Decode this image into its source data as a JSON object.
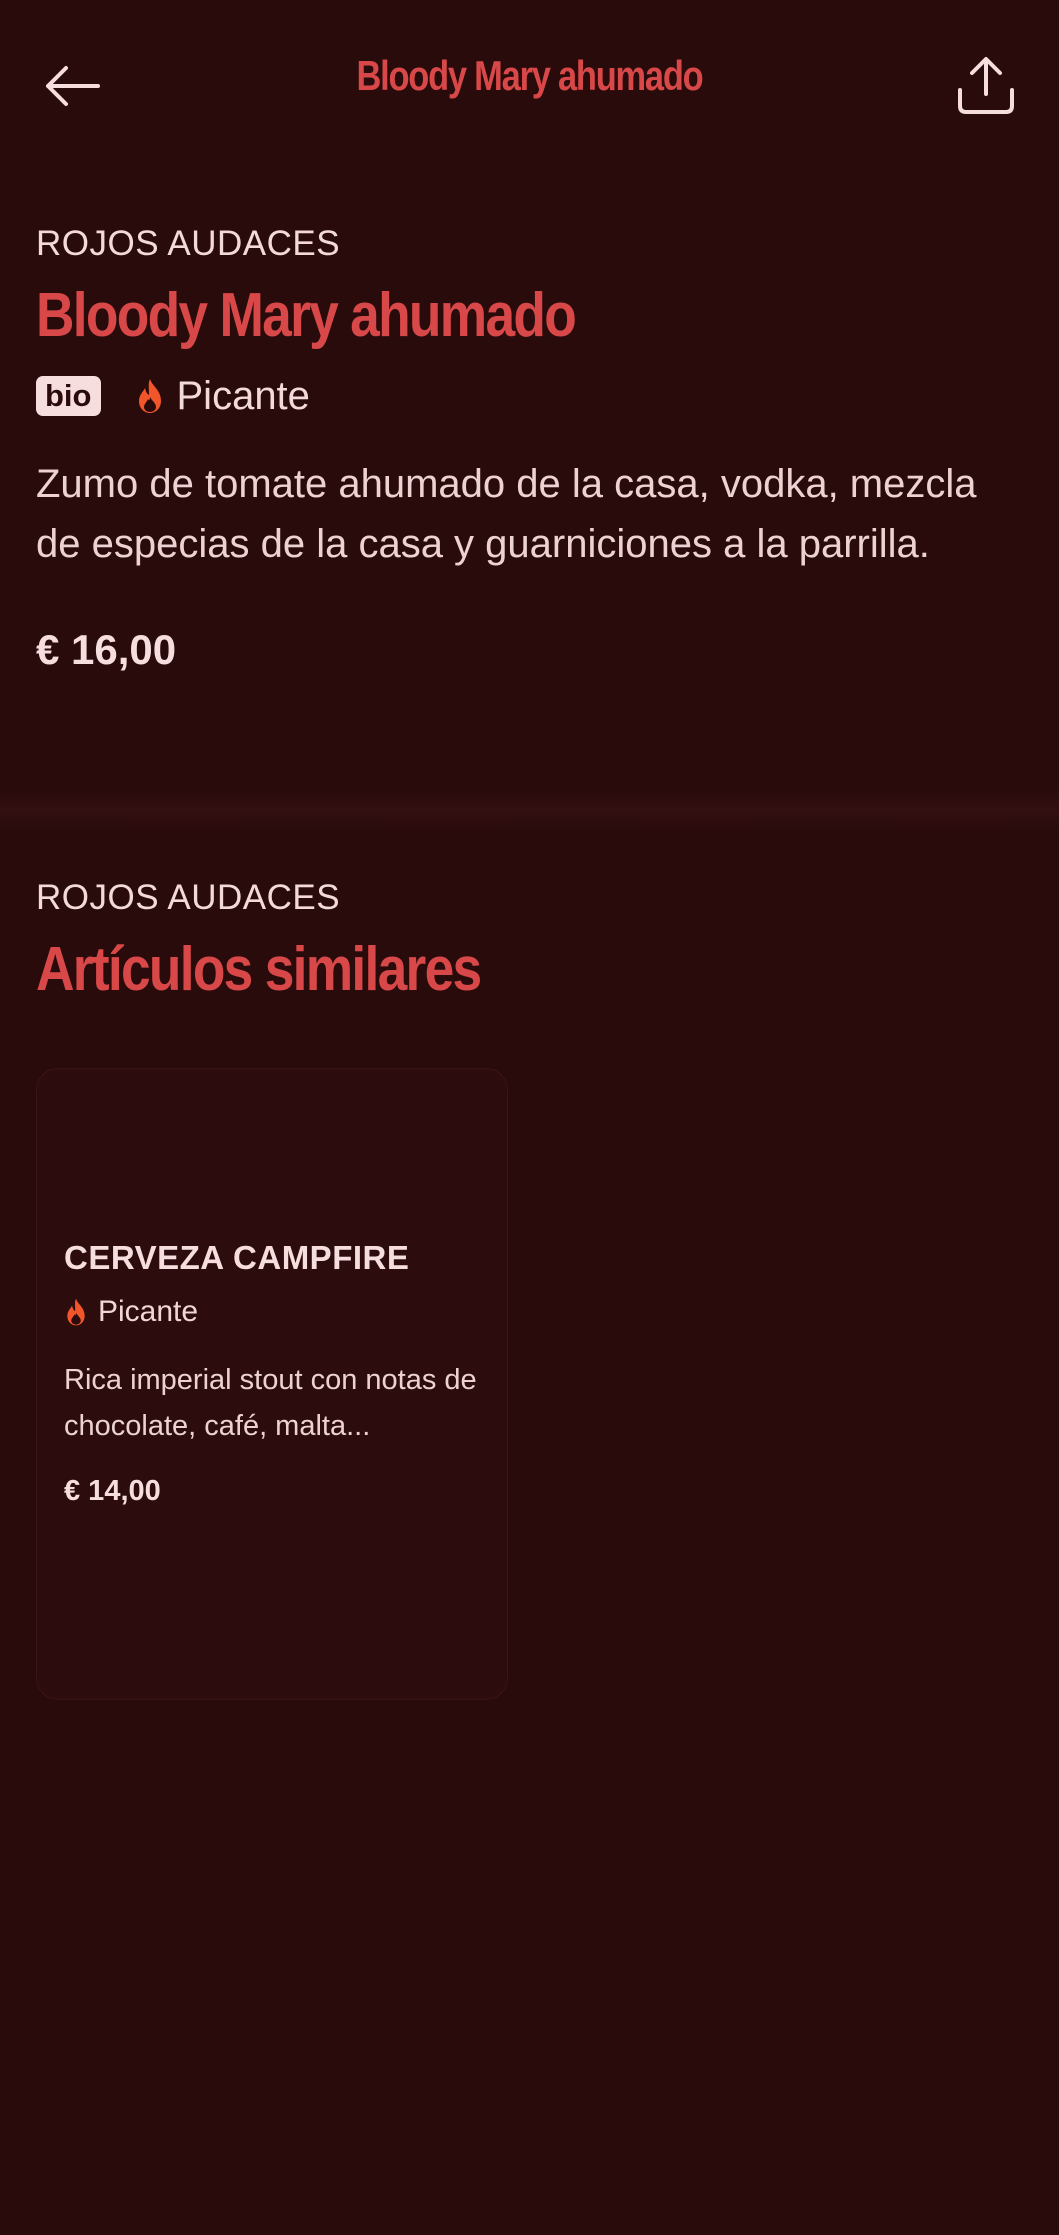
{
  "header": {
    "title": "Bloody Mary ahumado"
  },
  "product": {
    "category": "ROJOS AUDACES",
    "title": "Bloody Mary ahumado",
    "badge": "bio",
    "spicy_label": "Picante",
    "description": "Zumo de tomate ahumado de la casa, vodka, mezcla de especias de la casa y guarniciones a la parrilla.",
    "price": "€ 16,00"
  },
  "similar": {
    "category": "ROJOS AUDACES",
    "title": "Artículos similares",
    "items": [
      {
        "title": "CERVEZA CAMPFIRE",
        "spicy_label": "Picante",
        "description": "Rica imperial stout con notas de chocolate, café, malta...",
        "price": "€ 14,00"
      }
    ]
  },
  "colors": {
    "background": "#2a0b0c",
    "accent": "#d84848",
    "text": "#f6dede",
    "flame": "#f0562a"
  },
  "icons": {
    "back": "arrow-left-icon",
    "share": "share-icon",
    "spicy": "flame-icon"
  }
}
